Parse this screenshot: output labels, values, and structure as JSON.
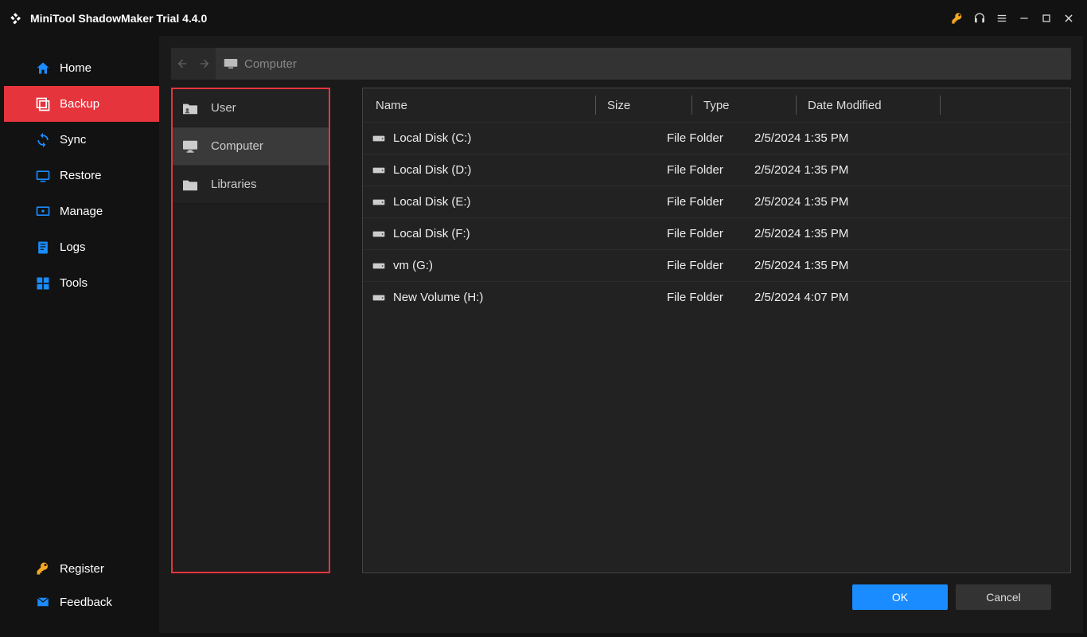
{
  "app": {
    "title": "MiniTool ShadowMaker Trial 4.4.0"
  },
  "sidebar": {
    "items": [
      {
        "label": "Home"
      },
      {
        "label": "Backup"
      },
      {
        "label": "Sync"
      },
      {
        "label": "Restore"
      },
      {
        "label": "Manage"
      },
      {
        "label": "Logs"
      },
      {
        "label": "Tools"
      }
    ],
    "bottom": [
      {
        "label": "Register"
      },
      {
        "label": "Feedback"
      }
    ]
  },
  "pathbar": {
    "location": "Computer"
  },
  "sources": [
    {
      "label": "User"
    },
    {
      "label": "Computer"
    },
    {
      "label": "Libraries"
    }
  ],
  "table": {
    "headers": {
      "name": "Name",
      "size": "Size",
      "type": "Type",
      "date": "Date Modified"
    },
    "rows": [
      {
        "name": "Local Disk (C:)",
        "size": "",
        "type": "File Folder",
        "date": "2/5/2024 1:35 PM"
      },
      {
        "name": "Local Disk (D:)",
        "size": "",
        "type": "File Folder",
        "date": "2/5/2024 1:35 PM"
      },
      {
        "name": "Local Disk (E:)",
        "size": "",
        "type": "File Folder",
        "date": "2/5/2024 1:35 PM"
      },
      {
        "name": "Local Disk (F:)",
        "size": "",
        "type": "File Folder",
        "date": "2/5/2024 1:35 PM"
      },
      {
        "name": "vm (G:)",
        "size": "",
        "type": "File Folder",
        "date": "2/5/2024 1:35 PM"
      },
      {
        "name": "New Volume (H:)",
        "size": "",
        "type": "File Folder",
        "date": "2/5/2024 4:07 PM"
      }
    ]
  },
  "footer": {
    "ok": "OK",
    "cancel": "Cancel"
  }
}
